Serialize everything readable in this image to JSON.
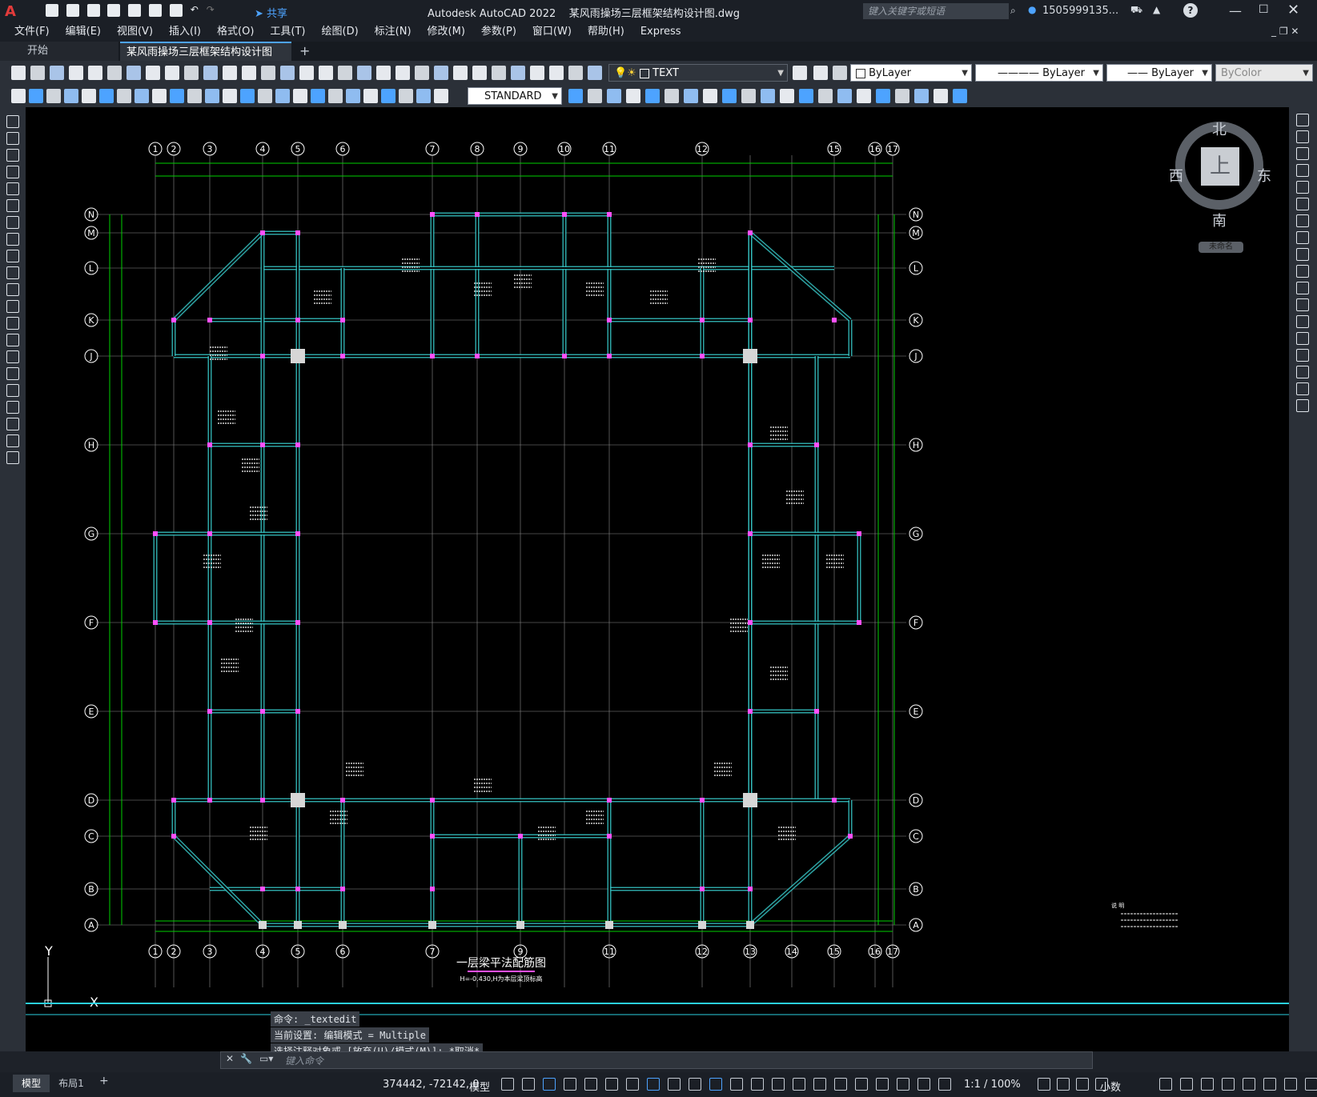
{
  "app": {
    "title": "Autodesk AutoCAD 2022",
    "document": "某风雨操场三层框架结构设计图.dwg",
    "share_label": "共享",
    "search_placeholder": "键入关键字或短语",
    "user": "1505999135...",
    "help": "?"
  },
  "menu": [
    "文件(F)",
    "编辑(E)",
    "视图(V)",
    "插入(I)",
    "格式(O)",
    "工具(T)",
    "绘图(D)",
    "标注(N)",
    "修改(M)",
    "参数(P)",
    "窗口(W)",
    "帮助(H)",
    "Express"
  ],
  "tabs": {
    "start": "开始",
    "drawing": "某风雨操场三层框架结构设计图*",
    "add": "+"
  },
  "toolbar": {
    "layer": "TEXT",
    "color": "ByLayer",
    "linetype": "ByLayer",
    "lineweight": "ByLayer",
    "plotstyle": "ByColor",
    "textstyle": "STANDARD"
  },
  "viewcube": {
    "north": "北",
    "south": "南",
    "east": "东",
    "west": "西",
    "top": "上",
    "wcs": "未命名"
  },
  "drawing": {
    "column_axes": [
      "1",
      "2",
      "3",
      "4",
      "5",
      "6",
      "7",
      "8",
      "9",
      "10",
      "11",
      "12",
      "15",
      "16",
      "17"
    ],
    "column_axes_bottom": [
      "1",
      "2",
      "3",
      "4",
      "5",
      "6",
      "7",
      "9",
      "11",
      "12",
      "13",
      "14",
      "15",
      "16",
      "17"
    ],
    "row_axes": [
      "N",
      "M",
      "L",
      "K",
      "J",
      "H",
      "G",
      "F",
      "E",
      "D",
      "C",
      "B",
      "A"
    ],
    "plan_title": "一层梁平法配筋图",
    "plan_subtitle": "H=-0.430,H为本层梁顶标高",
    "notes_title": "说 明",
    "ucs_x": "X",
    "ucs_y": "Y"
  },
  "command": {
    "history": [
      "命令: _textedit",
      "当前设置: 编辑模式 = Multiple",
      "选择注释对象或 [放弃(U)/模式(M)]: *取消*"
    ],
    "placeholder": "键入命令"
  },
  "status": {
    "model_tab": "模型",
    "layout_tab": "布局1",
    "add_tab": "+",
    "coords": "374442, -72142, 0",
    "space": "模型",
    "scale": "1:1 / 100%",
    "units": "小数"
  },
  "colors": {
    "canvas": "#000000",
    "axis_line": "#8c8c8c",
    "dim_line": "#00d000",
    "beam": "#35c0c0",
    "column_marker": "#ff50ff"
  }
}
